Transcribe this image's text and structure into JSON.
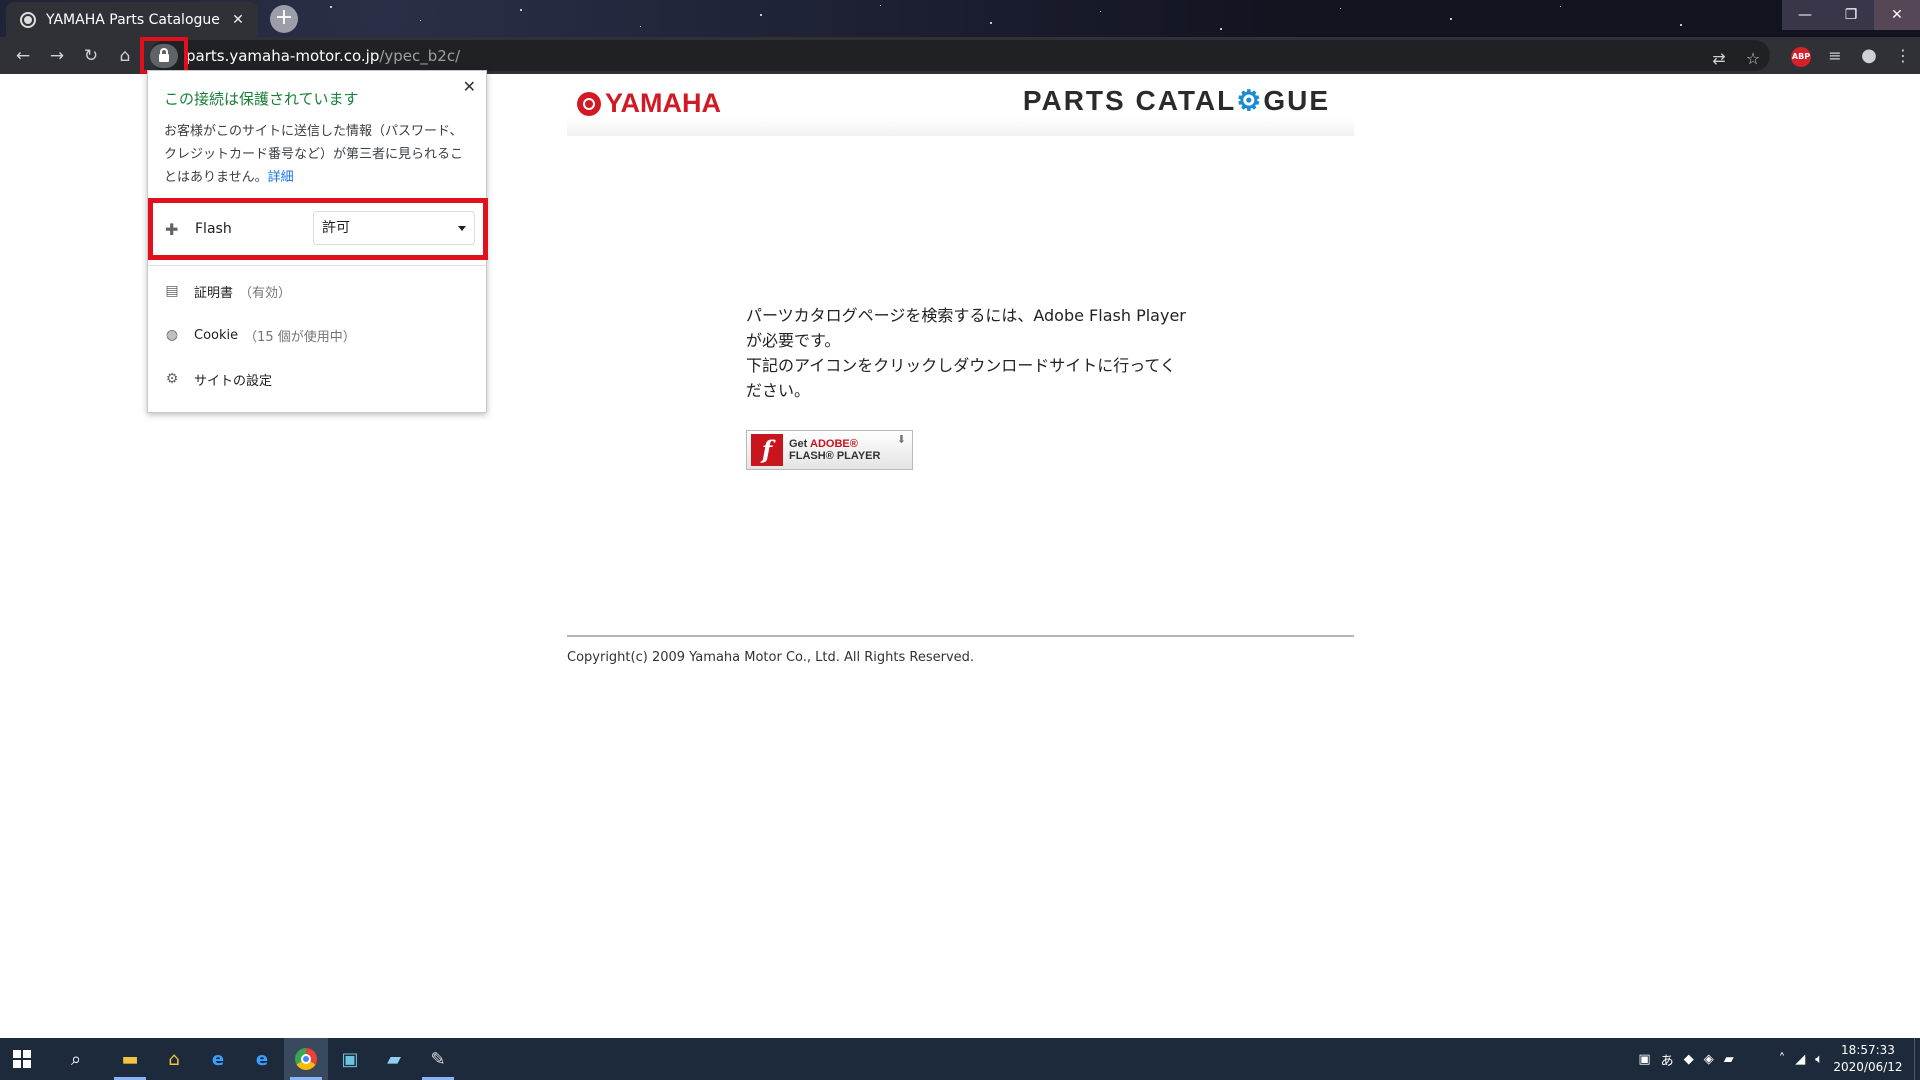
{
  "browser": {
    "tab_title": "YAMAHA Parts Catalogue",
    "tab_close": "✕",
    "new_tab": "+",
    "url_host": "parts.yamaha-motor.co.jp",
    "url_path": "/ypec_b2c/",
    "window_controls": {
      "minimize": "—",
      "maximize": "❐",
      "close": "✕"
    },
    "toolbar_icons": [
      "back-icon",
      "forward-icon",
      "reload-icon",
      "home-icon",
      "translate-icon",
      "bookmark-star-icon",
      "adblock-plus-icon",
      "reading-list-icon",
      "profile-icon",
      "menu-icon"
    ],
    "abp_label": "ABP"
  },
  "popup": {
    "title": "この接続は保護されています",
    "description": "お客様がこのサイトに送信した情報（パスワード、クレジットカード番号など）が第三者に見られることはありません。",
    "details_link": "詳細",
    "close": "✕",
    "flash": {
      "label": "Flash",
      "selected": "許可"
    },
    "items": [
      {
        "label": "証明書",
        "sub": "（有効）",
        "icon": "certificate-icon"
      },
      {
        "label": "Cookie",
        "sub": "（15 個が使用中）",
        "icon": "cookie-icon"
      },
      {
        "label": "サイトの設定",
        "sub": "",
        "icon": "gear-icon"
      }
    ],
    "highlight_color": "#e0101c"
  },
  "page": {
    "logo_text": "YAMAHA",
    "catalogue_pre": "PARTS CATAL",
    "catalogue_gear": "⚙",
    "catalogue_post": "GUE",
    "message_line1": "パーツカタログページを検索するには、Adobe Flash Playerが必要です。",
    "message_line2": "下記のアイコンをクリックしダウンロードサイトに行ってください。",
    "flash_button": {
      "get": "Get",
      "adobe": "ADOBE®",
      "player": "FLASH® PLAYER",
      "f": "f"
    },
    "copyright": "Copyright(c) 2009 Yamaha Motor Co., Ltd. All Rights Reserved."
  },
  "taskbar": {
    "apps": [
      "start-icon",
      "search-icon",
      "file-explorer-icon",
      "home-folder-icon",
      "internet-explorer-icon",
      "edge-icon",
      "chrome-icon",
      "app-icon",
      "notepad-icon",
      "paint-icon"
    ],
    "tray_ime": "あ",
    "time": "18:57:33",
    "date": "2020/06/12"
  }
}
